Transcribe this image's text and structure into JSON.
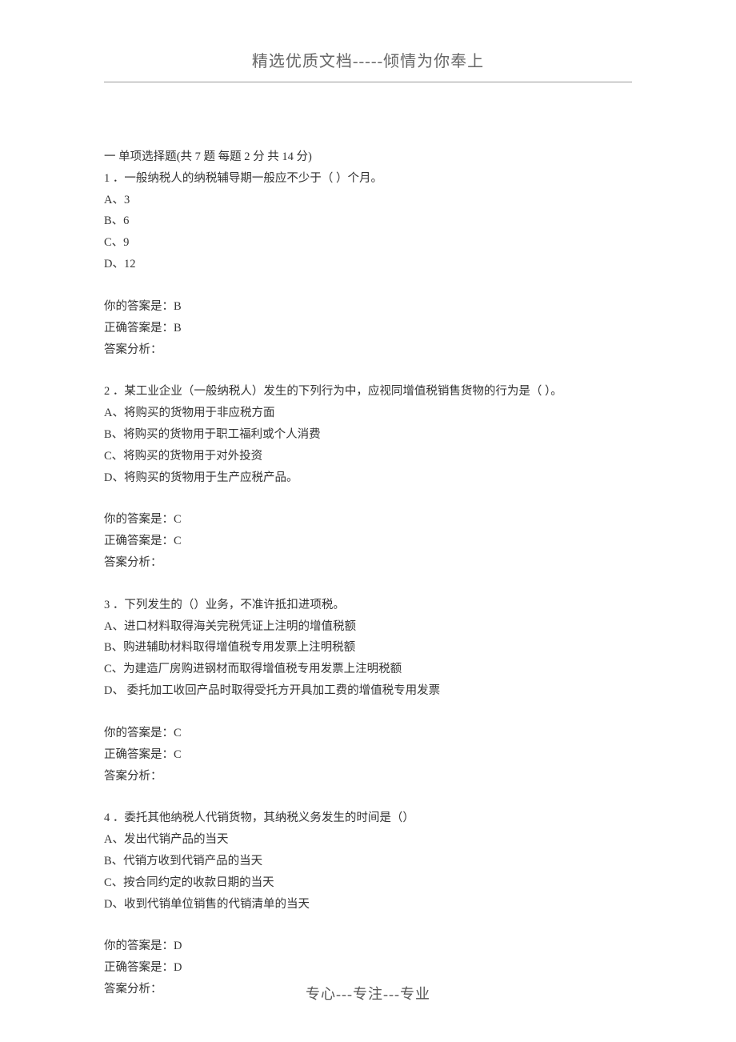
{
  "header": {
    "title": "精选优质文档-----倾情为你奉上"
  },
  "sectionHeader": "一  单项选择题(共 7 题  每题 2 分  共 14 分)",
  "questions": [
    {
      "stem": "1 ．一般纳税人的纳税辅导期一般应不少于（  ）个月。",
      "options": [
        "A、3",
        "B、6",
        "C、9",
        "D、12"
      ],
      "yourAnswer": "你的答案是：B",
      "correctAnswer": "正确答案是：B",
      "analysis": "答案分析："
    },
    {
      "stem": "2 ．某工业企业（一般纳税人）发生的下列行为中，应视同增值税销售货物的行为是（  ）。",
      "options": [
        "A、将购买的货物用于非应税方面",
        "B、将购买的货物用于职工福利或个人消费",
        "C、将购买的货物用于对外投资",
        "D、将购买的货物用于生产应税产品。"
      ],
      "yourAnswer": "你的答案是：C",
      "correctAnswer": "正确答案是：C",
      "analysis": "答案分析："
    },
    {
      "stem": "3 ．下列发生的（）业务，不准许抵扣进项税。",
      "options": [
        "A、进口材料取得海关完税凭证上注明的增值税额",
        "B、购进辅助材料取得增值税专用发票上注明税额",
        "C、为建造厂房购进钢材而取得增值税专用发票上注明税额",
        "D、 委托加工收回产品时取得受托方开具加工费的增值税专用发票"
      ],
      "yourAnswer": "你的答案是：C",
      "correctAnswer": "正确答案是：C",
      "analysis": "答案分析："
    },
    {
      "stem": "4 ．委托其他纳税人代销货物，其纳税义务发生的时间是（）",
      "options": [
        "A、发出代销产品的当天",
        "B、代销方收到代销产品的当天",
        "C、按合同约定的收款日期的当天",
        "D、收到代销单位销售的代销清单的当天"
      ],
      "yourAnswer": "你的答案是：D",
      "correctAnswer": "正确答案是：D",
      "analysis": "答案分析："
    }
  ],
  "footer": {
    "text": "专心---专注---专业"
  }
}
